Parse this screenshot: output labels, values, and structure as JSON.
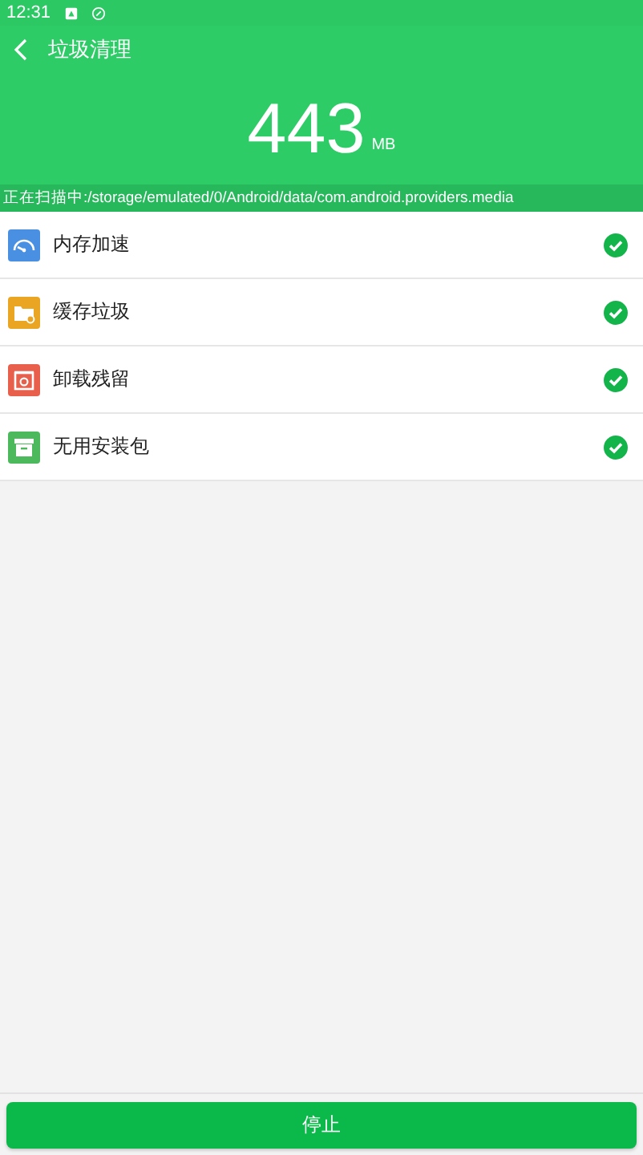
{
  "status_bar": {
    "time": "12:31"
  },
  "header": {
    "title": "垃圾清理",
    "size": "443",
    "unit": "MB"
  },
  "scan_path": "正在扫描中:/storage/emulated/0/Android/data/com.android.providers.media",
  "items": [
    {
      "kind": "speed",
      "label": "内存加速",
      "color": "#4a90e2",
      "checked": true
    },
    {
      "kind": "folder",
      "label": "缓存垃圾",
      "color": "#eaa623",
      "checked": true
    },
    {
      "kind": "uninstall",
      "label": "卸载残留",
      "color": "#e8604c",
      "checked": true
    },
    {
      "kind": "package",
      "label": "无用安装包",
      "color": "#4cb95c",
      "checked": true
    }
  ],
  "stop_button": "停止"
}
